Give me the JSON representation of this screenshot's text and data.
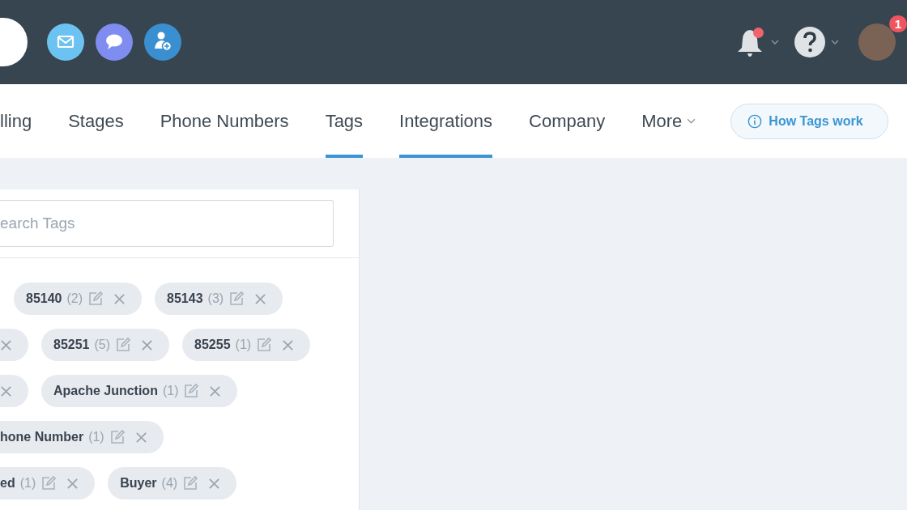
{
  "header": {
    "notification_dot": true,
    "avatar_badge": "1"
  },
  "tabs": [
    {
      "label": "lling",
      "kind": "link",
      "selected": false
    },
    {
      "label": "Stages",
      "kind": "link",
      "selected": false
    },
    {
      "label": "Phone Numbers",
      "kind": "link",
      "selected": false
    },
    {
      "label": "Tags",
      "kind": "link",
      "selected": true
    },
    {
      "label": "Integrations",
      "kind": "link",
      "selected": true
    },
    {
      "label": "Company",
      "kind": "link",
      "selected": false
    },
    {
      "label": "More",
      "kind": "dropdown",
      "selected": false
    }
  ],
  "help_button": "How Tags work",
  "search": {
    "placeholder": "earch Tags"
  },
  "tag_rows": [
    [
      {
        "kind": "full",
        "name": "85140",
        "count": "(2)"
      },
      {
        "kind": "full",
        "name": "85143",
        "count": "(3)"
      }
    ],
    [
      {
        "kind": "cut"
      },
      {
        "kind": "full",
        "name": "85251",
        "count": "(5)"
      },
      {
        "kind": "full",
        "name": "85255",
        "count": "(1)"
      }
    ],
    [
      {
        "kind": "cut"
      },
      {
        "kind": "full",
        "name": "Apache Junction",
        "count": "(1)"
      }
    ],
    [
      {
        "kind": "cut",
        "name": "hone Number",
        "count": "(1)"
      }
    ],
    [
      {
        "kind": "cut",
        "name": "ed",
        "count": "(1)"
      },
      {
        "kind": "full",
        "name": "Buyer",
        "count": "(4)"
      }
    ]
  ]
}
